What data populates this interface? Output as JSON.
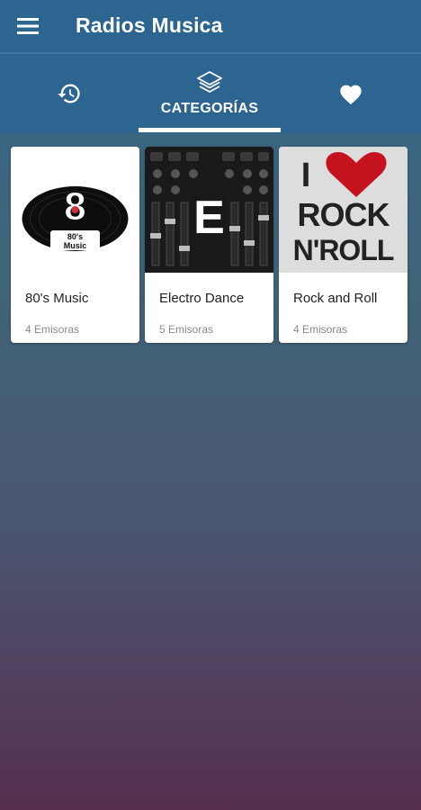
{
  "app": {
    "title": "Radios Musica",
    "menu_icon": "hamburger-menu-icon"
  },
  "colors": {
    "appbar": "#2c6590",
    "tab_indicator": "#ffffff",
    "background_top": "#35678a",
    "background_bottom": "#562f50"
  },
  "tabs": [
    {
      "icon": "history-icon",
      "label": ""
    },
    {
      "icon": "layers-icon",
      "label": "CATEGORÍAS",
      "selected": true
    },
    {
      "icon": "heart-icon",
      "label": ""
    }
  ],
  "categories": [
    {
      "name": "80's Music",
      "count": "4 Emisoras",
      "image": "80s-music-vinyl-logo",
      "logo_text": {
        "digit": "8",
        "line1": "80's",
        "line2": "Music"
      }
    },
    {
      "name": "Electro Dance",
      "count": "5 Emisoras",
      "image": "mixer-console-letter-e",
      "logo_text": {
        "letter": "E"
      }
    },
    {
      "name": "Rock and Roll",
      "count": "4 Emisoras",
      "image": "i-love-rock-n-roll",
      "logo_text": {
        "i": "I",
        "line1": "ROCK",
        "line2": "N'ROLL"
      }
    }
  ]
}
